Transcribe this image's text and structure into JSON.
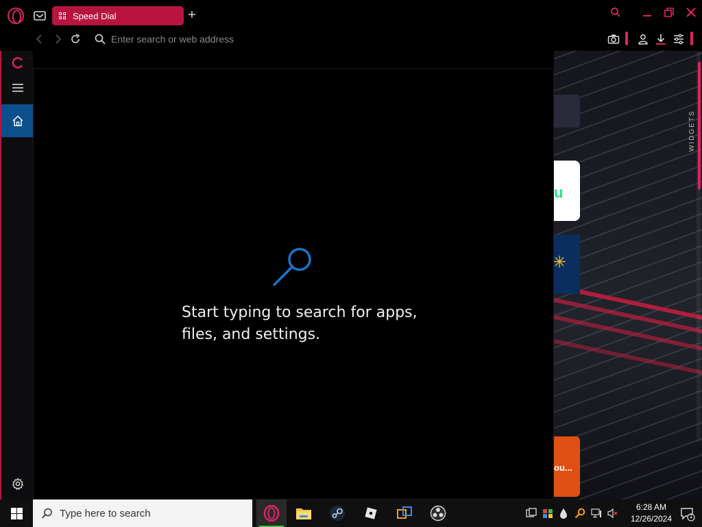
{
  "browser": {
    "tab_title": "Speed Dial",
    "address_placeholder": "Enter search or web address",
    "widgets_label": "WIDGETS"
  },
  "search_flyout": {
    "message": "Start typing to search for apps, files, and settings."
  },
  "taskbar": {
    "search_placeholder": "Type here to search",
    "apps": [
      "opera-icon",
      "file-explorer-icon",
      "steam-icon",
      "roblox-icon",
      "virtualbox-icon",
      "obs-icon"
    ],
    "time": "6:28 AM",
    "date": "12/26/2024",
    "notification_count": "1"
  },
  "speed_dial_peek": {
    "tile_2_text": "u",
    "tile_4_text": "ou..."
  },
  "colors": {
    "accent": "#e0245e",
    "home_active": "#0b4f8c",
    "search_icon": "#1e73c8"
  }
}
